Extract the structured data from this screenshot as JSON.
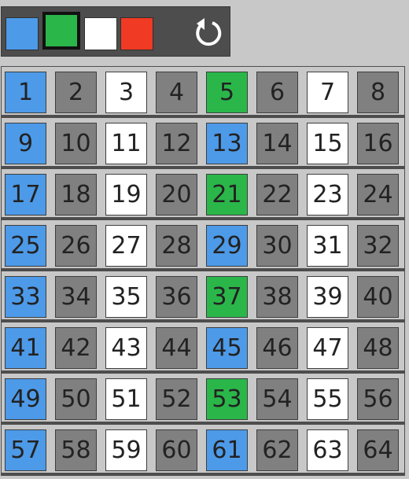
{
  "palette": {
    "colors": [
      {
        "name": "blue",
        "hex": "#4d9ae8",
        "selected": false
      },
      {
        "name": "green",
        "hex": "#2bb64a",
        "selected": true
      },
      {
        "name": "white",
        "hex": "#ffffff",
        "selected": false
      },
      {
        "name": "red",
        "hex": "#f03a24",
        "selected": false
      }
    ],
    "reset_icon": "reset-icon"
  },
  "grid": {
    "columns": 8,
    "rows": 8,
    "cells": [
      {
        "label": "1",
        "color": "blue"
      },
      {
        "label": "2",
        "color": "gray"
      },
      {
        "label": "3",
        "color": "white"
      },
      {
        "label": "4",
        "color": "gray"
      },
      {
        "label": "5",
        "color": "green"
      },
      {
        "label": "6",
        "color": "gray"
      },
      {
        "label": "7",
        "color": "white"
      },
      {
        "label": "8",
        "color": "gray"
      },
      {
        "label": "9",
        "color": "blue"
      },
      {
        "label": "10",
        "color": "gray"
      },
      {
        "label": "11",
        "color": "white"
      },
      {
        "label": "12",
        "color": "gray"
      },
      {
        "label": "13",
        "color": "blue"
      },
      {
        "label": "14",
        "color": "gray"
      },
      {
        "label": "15",
        "color": "white"
      },
      {
        "label": "16",
        "color": "gray"
      },
      {
        "label": "17",
        "color": "blue"
      },
      {
        "label": "18",
        "color": "gray"
      },
      {
        "label": "19",
        "color": "white"
      },
      {
        "label": "20",
        "color": "gray"
      },
      {
        "label": "21",
        "color": "green"
      },
      {
        "label": "22",
        "color": "gray"
      },
      {
        "label": "23",
        "color": "white"
      },
      {
        "label": "24",
        "color": "gray"
      },
      {
        "label": "25",
        "color": "blue"
      },
      {
        "label": "26",
        "color": "gray"
      },
      {
        "label": "27",
        "color": "white"
      },
      {
        "label": "28",
        "color": "gray"
      },
      {
        "label": "29",
        "color": "blue"
      },
      {
        "label": "30",
        "color": "gray"
      },
      {
        "label": "31",
        "color": "white"
      },
      {
        "label": "32",
        "color": "gray"
      },
      {
        "label": "33",
        "color": "blue"
      },
      {
        "label": "34",
        "color": "gray"
      },
      {
        "label": "35",
        "color": "white"
      },
      {
        "label": "36",
        "color": "gray"
      },
      {
        "label": "37",
        "color": "green"
      },
      {
        "label": "38",
        "color": "gray"
      },
      {
        "label": "39",
        "color": "white"
      },
      {
        "label": "40",
        "color": "gray"
      },
      {
        "label": "41",
        "color": "blue"
      },
      {
        "label": "42",
        "color": "gray"
      },
      {
        "label": "43",
        "color": "white"
      },
      {
        "label": "44",
        "color": "gray"
      },
      {
        "label": "45",
        "color": "blue"
      },
      {
        "label": "46",
        "color": "gray"
      },
      {
        "label": "47",
        "color": "white"
      },
      {
        "label": "48",
        "color": "gray"
      },
      {
        "label": "49",
        "color": "blue"
      },
      {
        "label": "50",
        "color": "gray"
      },
      {
        "label": "51",
        "color": "white"
      },
      {
        "label": "52",
        "color": "gray"
      },
      {
        "label": "53",
        "color": "green"
      },
      {
        "label": "54",
        "color": "gray"
      },
      {
        "label": "55",
        "color": "white"
      },
      {
        "label": "56",
        "color": "gray"
      },
      {
        "label": "57",
        "color": "blue"
      },
      {
        "label": "58",
        "color": "gray"
      },
      {
        "label": "59",
        "color": "white"
      },
      {
        "label": "60",
        "color": "gray"
      },
      {
        "label": "61",
        "color": "blue"
      },
      {
        "label": "62",
        "color": "gray"
      },
      {
        "label": "63",
        "color": "white"
      },
      {
        "label": "64",
        "color": "gray"
      }
    ]
  }
}
